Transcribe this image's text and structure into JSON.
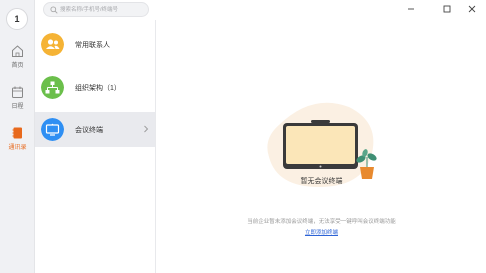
{
  "user": {
    "avatar_text": "1"
  },
  "rail": {
    "items": [
      {
        "label": "首页",
        "icon": "home-icon"
      },
      {
        "label": "日程",
        "icon": "calendar-icon"
      },
      {
        "label": "通讯录",
        "icon": "contacts-icon"
      }
    ],
    "active_color": "#e8691c"
  },
  "search": {
    "placeholder": "搜索名称/手机号/终端号",
    "value": ""
  },
  "list": {
    "items": [
      {
        "label": "常用联系人",
        "icon": "frequent-contacts-icon",
        "color": "#f5b335"
      },
      {
        "label": "组织架构（1）",
        "icon": "org-structure-icon",
        "color": "#6bbf4b"
      },
      {
        "label": "会议终端",
        "icon": "meeting-terminal-icon",
        "color": "#2f8ff3"
      }
    ]
  },
  "empty": {
    "title": "暂无会议终端",
    "description": "当前企业暂未添加会议终端，无法享受一键呼叫会议终端功能",
    "link": "立即添加终端"
  },
  "window": {
    "controls": [
      "minimize-icon",
      "maximize-icon",
      "close-icon"
    ]
  }
}
